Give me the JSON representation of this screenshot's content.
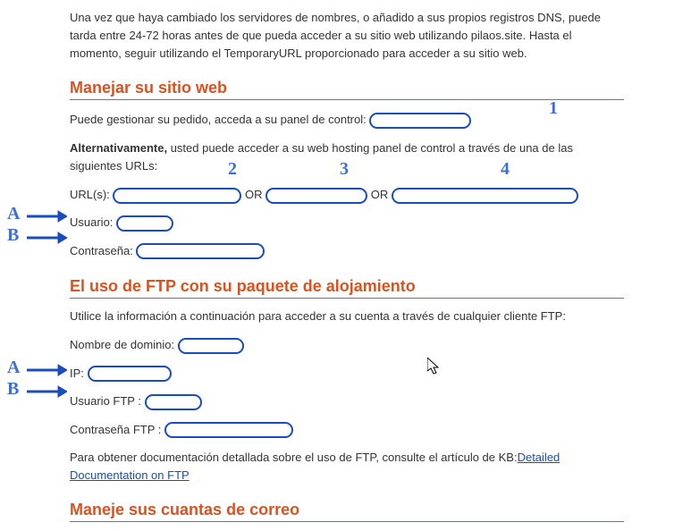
{
  "intro_paragraph": "Una vez que haya cambiado los servidores de nombres, o añadido a sus propios registros DNS, puede tarda entre 24-72 horas antes de que pueda acceder a su sitio web utilizando pilaos.site. Hasta el momento, seguir utilizando el TemporaryURL proporcionado para acceder a su sitio web.",
  "section_manage": {
    "heading": "Manejar su sitio web",
    "line1_prefix": "Puede gestionar su pedido, acceda a su panel de control:",
    "line2_bold": "Alternativamente,",
    "line2_rest": " usted puede acceder a su web hosting panel de control a través de una de las siguientes URLs:",
    "urls_label": "URL(s): ",
    "or1": " OR ",
    "or2": " OR ",
    "user_label": "Usuario: ",
    "pass_label": "Contraseña: "
  },
  "section_ftp": {
    "heading": "El uso de FTP con su paquete de alojamiento",
    "intro": "Utilice la información a continuación para acceder a su cuenta a través de cualquier cliente FTP:",
    "domain_label": "Nombre de dominio: ",
    "ip_label": "IP: ",
    "ftp_user_label": "Usuario FTP : ",
    "ftp_pass_label": "Contraseña FTP : ",
    "kb_prefix": "Para obtener documentación detallada sobre el uso de FTP, consulte el artículo de KB:",
    "kb_link": "Detailed Documentation on FTP"
  },
  "section_mail": {
    "heading": "Maneje sus cuantas de correo"
  },
  "annotations": {
    "n1": "1",
    "n2": "2",
    "n3": "3",
    "n4": "4",
    "A": "A",
    "B": "B"
  }
}
